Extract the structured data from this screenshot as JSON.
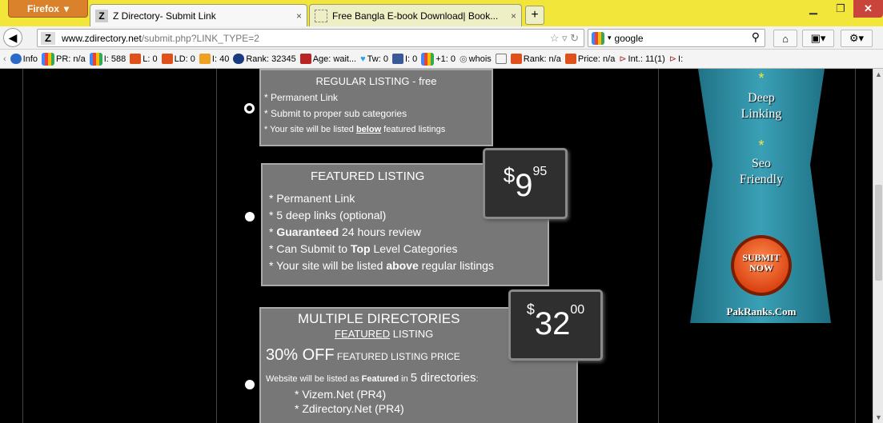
{
  "browser": {
    "menu_button": "Firefox",
    "tabs": [
      {
        "favicon": "Z",
        "title": "Z Directory- Submit Link",
        "close": "×"
      },
      {
        "favicon": "",
        "title": "Free Bangla E-book Download| Book...",
        "close": "×"
      }
    ],
    "new_tab": "+",
    "url_host": "www.zdirectory.net",
    "url_path": "/submit.php?LINK_TYPE=2",
    "search_engine": "google",
    "search_value": "google"
  },
  "seo_bar": {
    "info": "Info",
    "pr": "PR: n/a",
    "i": "I: 588",
    "l": "L: 0",
    "ld": "LD: 0",
    "i40": "I: 40",
    "rank": "Rank: 32345",
    "age": "Age: wait...",
    "tw": "Tw: 0",
    "fb": "I: 0",
    "gplus": "+1: 0",
    "whois": "whois",
    "rank_na": "Rank: n/a",
    "price": "Price: n/a",
    "int": "Int.: 11(1)",
    "ext": "I:"
  },
  "listings": {
    "regular": {
      "title": "REGULAR LISTING - free",
      "lines": [
        "* Permanent Link",
        "* Submit to proper sub categories"
      ],
      "line3_pre": "* Your site will be listed ",
      "line3_bold": "below",
      "line3_post": " featured listings"
    },
    "featured": {
      "title": "FEATURED LISTING",
      "price_currency": "$",
      "price_main": "9",
      "price_cents": "95",
      "l1": "* Permanent Link",
      "l2": "* 5 deep links (optional)",
      "l3_pre": "* ",
      "l3_bold": "Guaranteed",
      "l3_post": " 24 hours review",
      "l4_pre": "* Can Submit to ",
      "l4_bold": "Top",
      "l4_post": " Level Categories",
      "l5_pre": "* Your site will be listed ",
      "l5_bold": "above",
      "l5_post": " regular listings"
    },
    "multiple": {
      "title": "MULTIPLE DIRECTORIES",
      "subtitle_u": "FEATURED",
      "subtitle_rest": " LISTING",
      "price_currency": "$",
      "price_main": "32",
      "price_cents": "00",
      "off_big": "30% OFF",
      "off_small": " FEATURED LISTING PRICE",
      "desc_pre": "Website will be listed as ",
      "desc_bold": "Featured",
      "desc_mid": " in ",
      "desc_num": "5",
      "desc_dirs": " directories",
      "desc_end": ":",
      "dirs": [
        "* Vizem.Net (PR4)",
        "* Zdirectory.Net (PR4)"
      ]
    }
  },
  "ad": {
    "star": "*",
    "line1": "Deep",
    "line2": "Linking",
    "line3": "Seo",
    "line4": "Friendly",
    "btn1": "SUBMIT",
    "btn2": "NOW",
    "brand": "PakRanks.Com"
  },
  "colors": {
    "titlebar": "#f2e63a",
    "ad_blue": "#2a8aa0",
    "submit_orange": "#e8501c"
  }
}
